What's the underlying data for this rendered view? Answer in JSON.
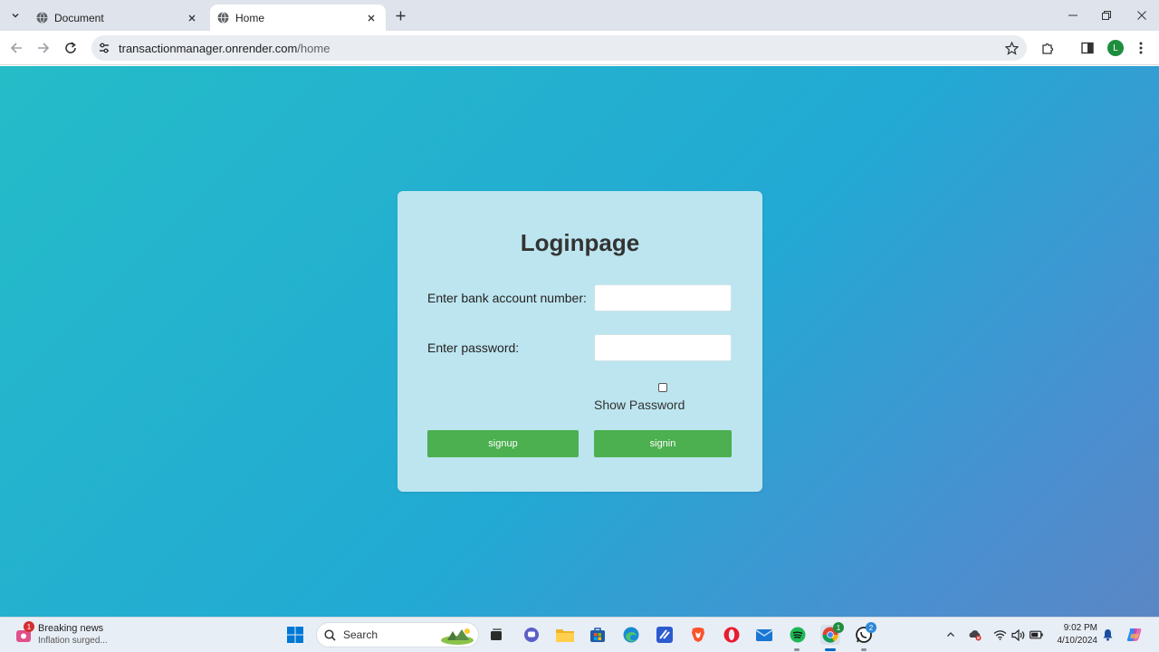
{
  "browser": {
    "tabs": [
      {
        "title": "Document",
        "active": false
      },
      {
        "title": "Home",
        "active": true
      }
    ],
    "url_host": "transactionmanager.onrender.com",
    "url_path": "/home",
    "profile_initial": "L"
  },
  "login": {
    "title": "Loginpage",
    "account_label": "Enter bank account number:",
    "account_value": "",
    "password_label": "Enter password:",
    "password_value": "",
    "show_password_label": "Show Password",
    "show_password_checked": false,
    "signup_label": "signup",
    "signin_label": "signin",
    "colors": {
      "card": "#bde5ef",
      "button": "#4caf50"
    }
  },
  "taskbar": {
    "news_title": "Breaking news",
    "news_subtitle": "Inflation surged...",
    "news_badge": "1",
    "search_label": "Search",
    "chrome_badge": "1",
    "whatsapp_badge": "2",
    "time": "9:02 PM",
    "date": "4/10/2024"
  }
}
